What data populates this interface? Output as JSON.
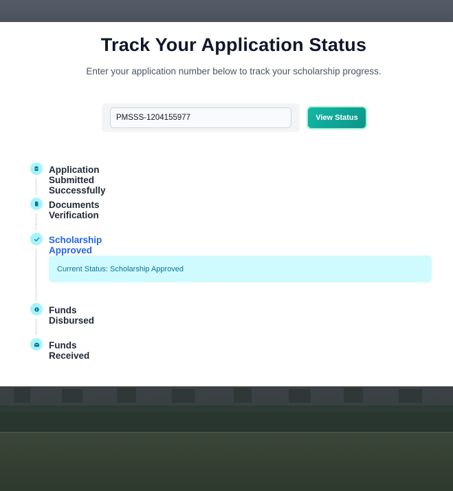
{
  "page": {
    "title": "Track Your Application Status",
    "subtitle": "Enter your application number below to track your scholarship progress."
  },
  "search": {
    "value": "PMSSS-1204155977",
    "button_label": "View Status"
  },
  "timeline": {
    "steps": [
      {
        "label": "Application Submitted Successfully",
        "icon": "clipboard-icon",
        "state": "done"
      },
      {
        "label": "Documents Verification",
        "icon": "document-icon",
        "state": "done"
      },
      {
        "label": "Scholarship Approved",
        "icon": "check-icon",
        "state": "current"
      },
      {
        "label": "Funds Disbursed",
        "icon": "coin-icon",
        "state": "pending"
      },
      {
        "label": "Funds Received",
        "icon": "inbox-icon",
        "state": "pending"
      }
    ],
    "status_text": "Current Status: Scholarship Approved"
  },
  "colors": {
    "accent": "#14b8a6",
    "active_step": "#2563eb",
    "dot_fill": "#a5f3fc",
    "status_bg": "#cffafe",
    "status_text": "#0e7490"
  }
}
